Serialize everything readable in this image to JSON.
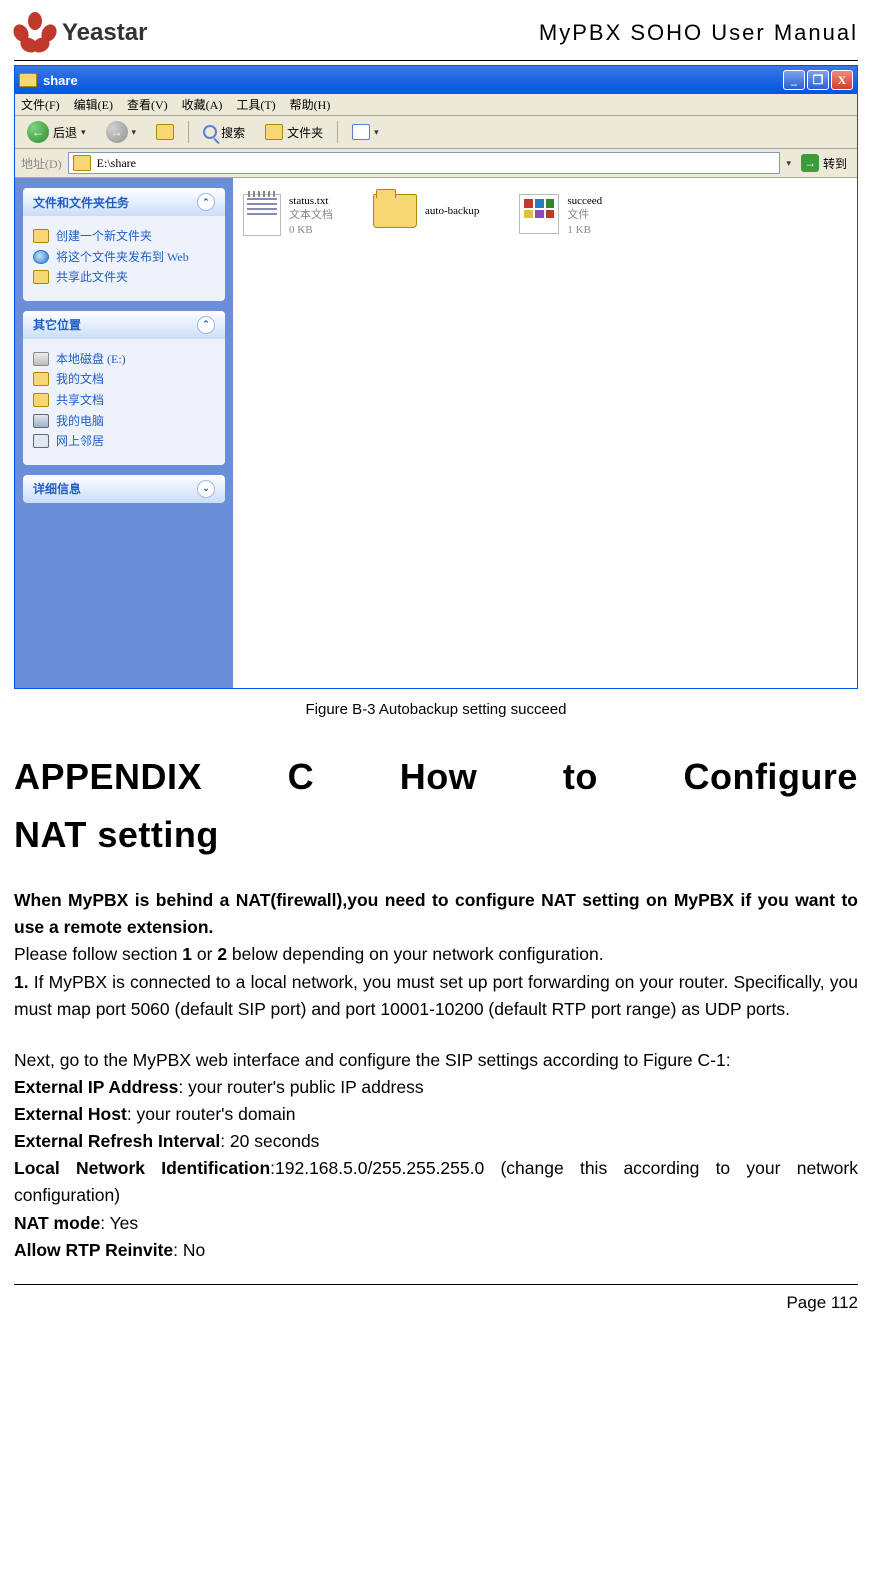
{
  "header": {
    "brand": "Yeastar",
    "doc_title": "MyPBX SOHO User Manual"
  },
  "window": {
    "title": "share",
    "menus": {
      "file": "文件(F)",
      "edit": "编辑(E)",
      "view": "查看(V)",
      "fav": "收藏(A)",
      "tools": "工具(T)",
      "help": "帮助(H)"
    },
    "toolbar": {
      "back": "后退",
      "search": "搜索",
      "folders": "文件夹"
    },
    "address": {
      "label": "地址(D)",
      "path": "E:\\share",
      "go": "转到"
    },
    "side": {
      "tasks_title": "文件和文件夹任务",
      "tasks": {
        "t1": "创建一个新文件夹",
        "t2": "将这个文件夹发布到 Web",
        "t3": "共享此文件夹"
      },
      "places_title": "其它位置",
      "places": {
        "p1": "本地磁盘 (E:)",
        "p2": "我的文档",
        "p3": "共享文档",
        "p4": "我的电脑",
        "p5": "网上邻居"
      },
      "details_title": "详细信息"
    },
    "files": {
      "f1": {
        "name": "status.txt",
        "l2": "文本文档",
        "l3": "0 KB"
      },
      "f2": {
        "name": "auto-backup"
      },
      "f3": {
        "name": "succeed",
        "l2": "文件",
        "l3": "1 KB"
      }
    }
  },
  "caption": "Figure B-3 Autobackup setting succeed",
  "appendix": {
    "w1": "APPENDIX",
    "w2": "C",
    "w3": "How",
    "w4": "to",
    "w5": "Configure",
    "line2": "NAT setting"
  },
  "body": {
    "p1a": "When MyPBX is behind a NAT(firewall),you need to configure NAT setting on MyPBX if you want to use a remote extension.",
    "p2": "Please follow section ",
    "p2b1": "1",
    "p2m": " or ",
    "p2b2": "2",
    "p2e": " below depending on your network configuration.",
    "p3a": "1.",
    "p3b": " If MyPBX is connected to a local network, you must set up port forwarding on your router. Specifically, you must map port 5060 (default SIP port) and port 10001-10200 (default RTP port range) as UDP ports.",
    "p4": "Next, go to the MyPBX web interface and configure the SIP settings according to Figure C-1:",
    "l1a": "External IP Address",
    "l1b": ": your router's public IP address",
    "l2a": "External Host",
    "l2b": ": your router's domain",
    "l3a": "External Refresh Interval",
    "l3b": ": 20 seconds",
    "l4a": "Local Network Identification",
    "l4b": ":192.168.5.0/255.255.255.0 (change this according to your network configuration)",
    "l5a": "NAT mode",
    "l5b": ": Yes",
    "l6a": "Allow RTP Reinvite",
    "l6b": ": No"
  },
  "footer": {
    "page": "Page 112"
  }
}
